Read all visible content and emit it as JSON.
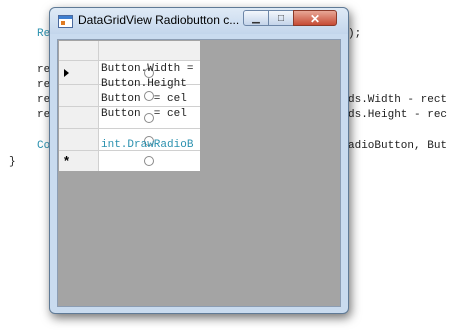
{
  "window": {
    "title": "DataGridView Radiobutton c...",
    "minimize_glyph": "▁",
    "maximize_glyph": "□",
    "close_glyph": "✕"
  },
  "code_lines": [
    "Re",
    "re",
    "re",
    "re",
    "re",
    "Co",
    "}",
    ");",
    "ds.Width - rect",
    "ds.Height - rec",
    "adioButton, But"
  ],
  "grid": {
    "row_indicators": [
      "current-row-arrow",
      "new-row-asterisk"
    ],
    "new_row_symbol": "*",
    "overlay_text": [
      "Button.Width =",
      "Button.Height",
      "Button  = cel",
      "Button  = cel",
      "int.DrawRadioB"
    ]
  },
  "colors": {
    "client_background": "#a4a4a4",
    "title_gradient_top": "#dfeaf6",
    "close_button": "#c64b35"
  }
}
